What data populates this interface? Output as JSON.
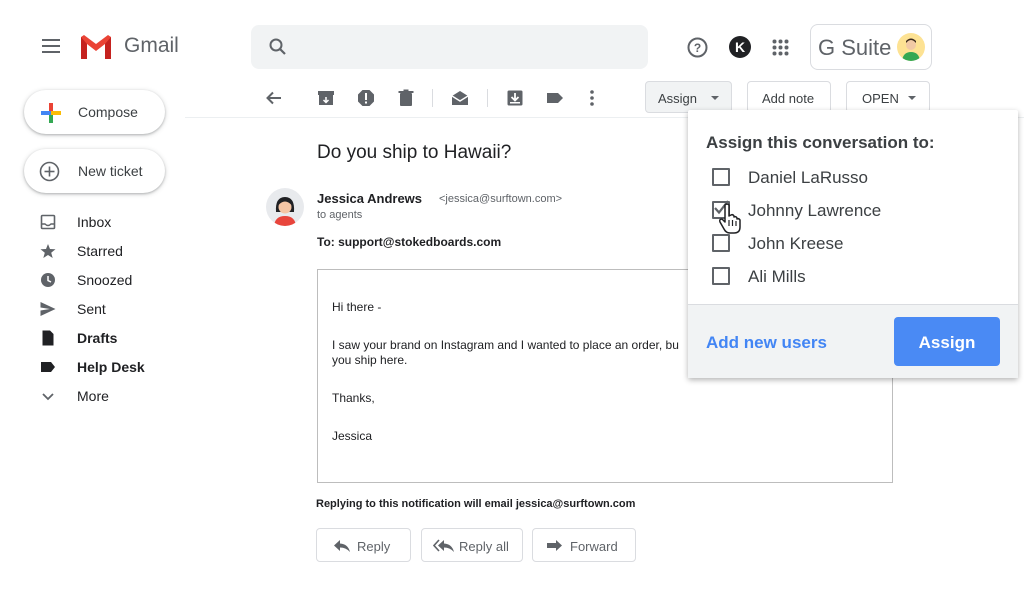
{
  "header": {
    "app_name": "Gmail",
    "search_placeholder": "",
    "gsuite_label": "G Suite",
    "profile_initial": "K"
  },
  "sidebar": {
    "compose_label": "Compose",
    "new_ticket_label": "New ticket",
    "items": [
      {
        "label": "Inbox",
        "icon": "inbox-icon",
        "bold": false
      },
      {
        "label": "Starred",
        "icon": "star-icon",
        "bold": false
      },
      {
        "label": "Snoozed",
        "icon": "clock-icon",
        "bold": false
      },
      {
        "label": "Sent",
        "icon": "send-icon",
        "bold": false
      },
      {
        "label": "Drafts",
        "icon": "draft-icon",
        "bold": true
      },
      {
        "label": "Help Desk",
        "icon": "label-icon",
        "bold": true
      },
      {
        "label": "More",
        "icon": "chevron-down-icon",
        "bold": false
      }
    ]
  },
  "toolbar": {
    "assign_label": "Assign",
    "add_note_label": "Add note",
    "status_label": "OPEN"
  },
  "message": {
    "subject": "Do you ship to Hawaii?",
    "sender_name": "Jessica Andrews",
    "sender_email": "<jessica@surftown.com>",
    "recipient_line": "to agents",
    "to_line": "To: support@stokedboards.com",
    "body": {
      "greeting": "Hi there -",
      "line1": "I saw your brand on Instagram and I wanted to place an order, bu",
      "line2": "you ship here.",
      "closing": "Thanks,",
      "signature": "Jessica"
    },
    "reply_note": "Replying to this notification will email jessica@surftown.com",
    "actions": {
      "reply": "Reply",
      "reply_all": "Reply all",
      "forward": "Forward"
    }
  },
  "assign_popup": {
    "title": "Assign this conversation to:",
    "users": [
      {
        "name": "Daniel LaRusso",
        "checked": false
      },
      {
        "name": "Johnny Lawrence",
        "checked": true
      },
      {
        "name": "John Kreese",
        "checked": false
      },
      {
        "name": "Ali Mills",
        "checked": false
      }
    ],
    "add_users_label": "Add new users",
    "submit_label": "Assign"
  },
  "colors": {
    "accent_blue": "#4a8af4",
    "gmail_red": "#ea4335"
  }
}
